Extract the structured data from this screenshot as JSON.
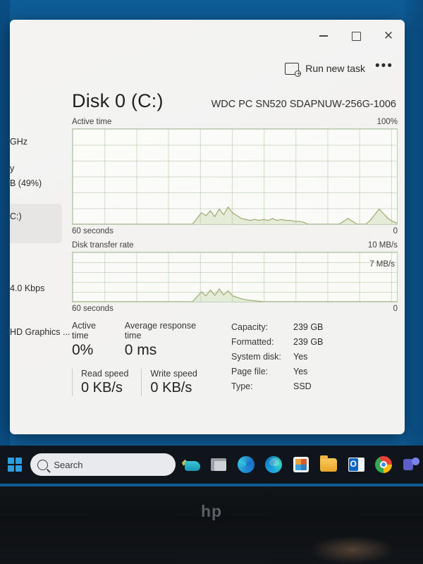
{
  "window": {
    "titlebar": {
      "minimize_label": "—",
      "maximize_label": "□",
      "close_label": "✕"
    },
    "toolbar": {
      "run_new_task_label": "Run new task",
      "more_label": "•••"
    }
  },
  "sidebar": {
    "items": [
      {
        "label": "GHz"
      },
      {
        "label": "y"
      },
      {
        "label": "B (49%)"
      },
      {
        "label": "C:)"
      },
      {
        "label": "4.0 Kbps"
      },
      {
        "label": "HD Graphics ..."
      }
    ]
  },
  "main": {
    "title": "Disk 0 (C:)",
    "model": "WDC PC SN520 SDAPNUW-256G-1006",
    "graphs": [
      {
        "name": "Active time",
        "top_right": "100%",
        "bottom_left": "60 seconds",
        "bottom_right": "0"
      },
      {
        "name": "Disk transfer rate",
        "top_right": "10 MB/s",
        "inner_right": "7 MB/s",
        "bottom_left": "60 seconds",
        "bottom_right": "0"
      }
    ],
    "stats": {
      "active_time_label": "Active time",
      "active_time_value": "0%",
      "avg_response_label": "Average response time",
      "avg_response_value": "0 ms",
      "read_speed_label": "Read speed",
      "read_speed_value": "0 KB/s",
      "write_speed_label": "Write speed",
      "write_speed_value": "0 KB/s",
      "details": [
        {
          "key": "Capacity:",
          "value": "239 GB"
        },
        {
          "key": "Formatted:",
          "value": "239 GB"
        },
        {
          "key": "System disk:",
          "value": "Yes"
        },
        {
          "key": "Page file:",
          "value": "Yes"
        },
        {
          "key": "Type:",
          "value": "SSD"
        }
      ]
    }
  },
  "taskbar": {
    "search_placeholder": "Search",
    "items": [
      {
        "name": "start-button",
        "label": "Start"
      },
      {
        "name": "search-box",
        "label": "Search"
      },
      {
        "name": "tools-icon",
        "label": "Tools"
      },
      {
        "name": "task-view-icon",
        "label": "Task View"
      },
      {
        "name": "copilot-icon",
        "label": "Copilot"
      },
      {
        "name": "edge-icon",
        "label": "Microsoft Edge"
      },
      {
        "name": "store-icon",
        "label": "Microsoft Store"
      },
      {
        "name": "file-explorer-icon",
        "label": "File Explorer"
      },
      {
        "name": "outlook-icon",
        "label": "Outlook"
      },
      {
        "name": "chrome-icon",
        "label": "Google Chrome"
      },
      {
        "name": "teams-icon",
        "label": "Microsoft Teams"
      }
    ]
  },
  "device": {
    "brand": "hp"
  },
  "chart_data": [
    {
      "type": "area",
      "title": "Active time",
      "ylabel": "%",
      "xlabel": "60 seconds",
      "ylim": [
        0,
        100
      ],
      "grid": true,
      "series": [
        {
          "name": "Active time",
          "values": [
            0,
            0,
            0,
            0,
            0,
            0,
            0,
            0,
            0,
            0,
            0,
            0,
            0,
            0,
            0,
            0,
            0,
            0,
            0,
            0,
            0,
            0,
            0,
            0,
            0,
            0,
            0,
            0,
            6,
            12,
            9,
            14,
            8,
            16,
            10,
            18,
            12,
            9,
            6,
            5,
            4,
            5,
            4,
            5,
            4,
            6,
            4,
            5,
            4,
            4,
            3,
            3,
            2,
            0,
            0,
            0,
            0,
            0,
            0,
            0,
            0,
            3,
            6,
            3,
            0,
            0,
            0,
            4,
            10,
            16,
            11,
            6,
            3,
            1
          ]
        }
      ]
    },
    {
      "type": "area",
      "title": "Disk transfer rate",
      "ylabel": "MB/s",
      "xlabel": "60 seconds",
      "ylim": [
        0,
        10
      ],
      "reference_line": 7,
      "grid": true,
      "series": [
        {
          "name": "Transfer rate",
          "values": [
            0,
            0,
            0,
            0,
            0,
            0,
            0,
            0,
            0,
            0,
            0,
            0,
            0,
            0,
            0,
            0,
            0,
            0,
            0,
            0,
            0,
            0,
            0,
            0,
            0,
            0,
            0,
            0,
            1.0,
            2.0,
            1.2,
            2.4,
            1.3,
            2.6,
            1.4,
            2.2,
            1.2,
            0.9,
            0.6,
            0.4,
            0.3,
            0.2,
            0.1,
            0,
            0,
            0,
            0,
            0,
            0,
            0,
            0,
            0,
            0,
            0,
            0,
            0,
            0,
            0,
            0,
            0,
            0,
            0,
            0,
            0,
            0,
            0,
            0,
            0,
            0,
            0,
            0,
            0,
            0,
            0
          ]
        }
      ]
    }
  ]
}
